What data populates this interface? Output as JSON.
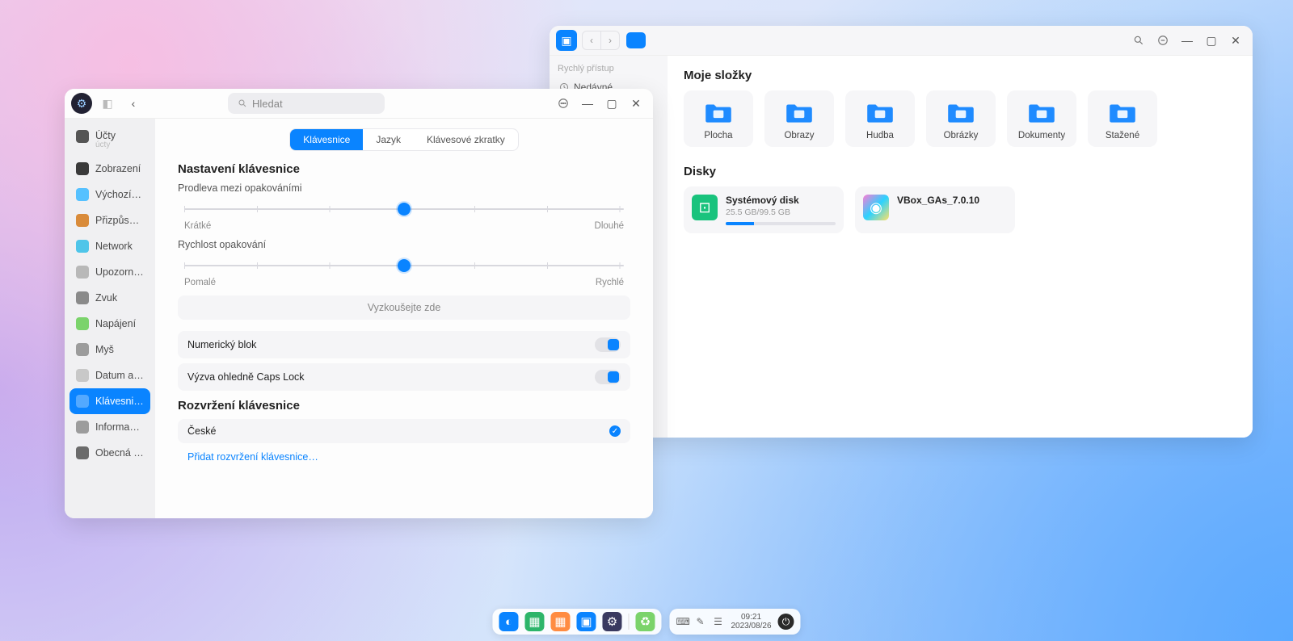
{
  "settings": {
    "search_placeholder": "Hledat",
    "sidebar": [
      {
        "id": "accounts",
        "label": "Účty",
        "sub": "úcty",
        "color": "#555"
      },
      {
        "id": "display",
        "label": "Zobrazení",
        "color": "#3a3a3a"
      },
      {
        "id": "defaults",
        "label": "Výchozí pr…",
        "color": "#56c1ff"
      },
      {
        "id": "personalize",
        "label": "Přizpůsob…",
        "color": "#d98b3a"
      },
      {
        "id": "network",
        "label": "Network",
        "color": "#4fc5e9"
      },
      {
        "id": "notifications",
        "label": "Upozornění",
        "color": "#b8b8b8"
      },
      {
        "id": "sound",
        "label": "Zvuk",
        "color": "#8a8a8a"
      },
      {
        "id": "power",
        "label": "Napájení",
        "color": "#7bd36b"
      },
      {
        "id": "mouse",
        "label": "Myš",
        "color": "#9c9c9c"
      },
      {
        "id": "datetime",
        "label": "Datum a čas",
        "color": "#c8c8c8"
      },
      {
        "id": "keyboard",
        "label": "Klávesnice…",
        "color": "#ffffff",
        "active": true
      },
      {
        "id": "sysinfo",
        "label": "Informace …",
        "color": "#9c9c9c"
      },
      {
        "id": "general",
        "label": "Obecná na…",
        "color": "#6b6b6b"
      }
    ],
    "tabs": [
      {
        "id": "keyboard",
        "label": "Klávesnice",
        "active": true
      },
      {
        "id": "language",
        "label": "Jazyk"
      },
      {
        "id": "shortcuts",
        "label": "Klávesové zkratky"
      }
    ],
    "section_keyboard_settings": "Nastavení klávesnice",
    "repeat_delay": {
      "label": "Prodleva mezi opakováními",
      "min": "Krátké",
      "max": "Dlouhé",
      "value_pct": 50
    },
    "repeat_rate": {
      "label": "Rychlost opakování",
      "min": "Pomalé",
      "max": "Rychlé",
      "value_pct": 50
    },
    "try_here": "Vyzkoušejte zde",
    "numlock": {
      "label": "Numerický blok",
      "on": true
    },
    "capsprompt": {
      "label": "Výzva ohledně Caps Lock",
      "on": true
    },
    "section_layout": "Rozvržení klávesnice",
    "layouts": [
      {
        "name": "České",
        "selected": true
      }
    ],
    "add_layout": "Přidat rozvržení klávesnice…"
  },
  "files": {
    "sidebar_section": "Rychlý přístup",
    "sidebar_items": [
      {
        "id": "recent",
        "label": "Nedávné",
        "icon": "clock"
      }
    ],
    "header_folders": "Moje složky",
    "folders": [
      {
        "id": "desktop",
        "label": "Plocha",
        "glyph": "▭"
      },
      {
        "id": "pictures_alt",
        "label": "Obrazy",
        "glyph": "◔"
      },
      {
        "id": "music",
        "label": "Hudba",
        "glyph": "♪"
      },
      {
        "id": "pictures",
        "label": "Obrázky",
        "glyph": "▤"
      },
      {
        "id": "documents",
        "label": "Dokumenty",
        "glyph": "≣"
      },
      {
        "id": "downloads",
        "label": "Stažené",
        "glyph": "↓"
      }
    ],
    "header_disks": "Disky",
    "disks": [
      {
        "id": "system",
        "name": "Systémový disk",
        "capacity": "25.5 GB/99.5 GB",
        "pct": 26,
        "icon_bg": "#19c37d"
      },
      {
        "id": "vbox",
        "name": "VBox_GAs_7.0.10",
        "capacity": "",
        "pct": 0,
        "icon_bg": "linear-gradient(135deg,#ff7bd5,#2bd2ff,#ffe166)"
      }
    ]
  },
  "dock": {
    "apps": [
      {
        "id": "launcher",
        "color": "#0a84ff",
        "glyph": "◐"
      },
      {
        "id": "spreadsheet",
        "color": "#2db56a",
        "glyph": "▦"
      },
      {
        "id": "grid",
        "color": "#ff8c42",
        "glyph": "▦"
      },
      {
        "id": "files",
        "color": "#0a84ff",
        "glyph": "▣"
      },
      {
        "id": "settings",
        "color": "#3a3a60",
        "glyph": "⚙"
      },
      {
        "id": "trash",
        "color": "#7bd36b",
        "glyph": "♻"
      }
    ],
    "tray": {
      "icons": [
        "⌨",
        "✎",
        "☰"
      ],
      "time": "09:21",
      "date": "2023/08/26"
    }
  }
}
